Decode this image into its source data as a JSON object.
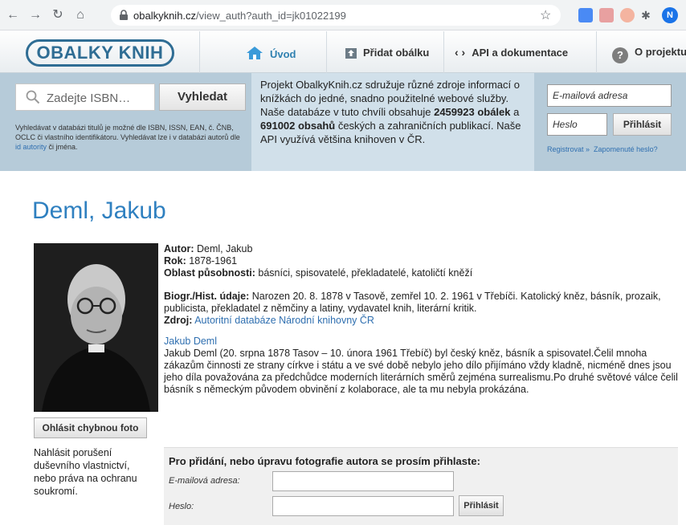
{
  "browser": {
    "url_domain": "obalkyknih.cz",
    "url_path": "/view_auth?auth_id=jk01022199",
    "avatar_letter": "N"
  },
  "header": {
    "logo": "OBALKY KNIH",
    "nav": [
      {
        "label": "Úvod",
        "icon": "home-icon"
      },
      {
        "label": "Přidat obálku",
        "icon": "upload-icon"
      },
      {
        "label": "API a dokumentace",
        "icon": "code-icon"
      },
      {
        "label": "O projektu",
        "icon": "help-icon"
      }
    ]
  },
  "search": {
    "placeholder": "Zadejte ISBN…",
    "button": "Vyhledat",
    "help_prefix": "Vyhledávat v databázi titulů je možné dle ISBN, ISSN, EAN, č. ČNB, OCLC či vlastního identifikátoru. Vyhledávat lze i v databázi autorů dle ",
    "help_link": "id autority",
    "help_suffix": " či jména."
  },
  "info": {
    "line1": "Projekt ObalkyKnih.cz sdružuje různé zdroje informací o knížkách do jedné, snadno použitelné webové služby. Naše databáze v tuto chvíli obsahuje ",
    "covers": "2459923 obálek",
    "mid": " a ",
    "contents": "691002 obsahů",
    "line2": " českých a zahraničních publikací. Naše API využívá většina knihoven v ČR."
  },
  "login": {
    "email_placeholder": "E-mailová adresa",
    "password_placeholder": "Heslo",
    "button": "Přihlásit",
    "register": "Registrovat »",
    "forgot": "Zapomenuté heslo?"
  },
  "author": {
    "name": "Deml, Jakub",
    "report_button": "Ohlásit chybnou foto",
    "rights_note": "Nahlásit porušení duševního vlastnictví, nebo práva na ochranu soukromí.",
    "fields": {
      "author_label": "Autor:",
      "author_value": " Deml, Jakub",
      "year_label": "Rok:",
      "year_value": " 1878-1961",
      "area_label": "Oblast působnosti:",
      "area_value": " básníci, spisovatelé, překladatelé, katoličtí kněží",
      "bio_label": "Biogr./Hist. údaje:",
      "bio_value": " Narozen 20. 8. 1878 v Tasově, zemřel 10. 2. 1961 v Třebíči. Katolický kněz, básník, prozaik, publicista, překladatel z němčiny a latiny, vydavatel knih, literární kritik.",
      "source_label": "Zdroj:",
      "source_value": "Autoritní databáze Národní knihovny ČR"
    },
    "wiki_title": "Jakub Deml",
    "wiki_text": "Jakub Deml (20. srpna 1878 Tasov – 10. února 1961 Třebíč) byl český kněz, básník a spisovatel.Čelil mnoha zákazům činnosti ze strany církve i státu a ve své době nebylo jeho dílo přijímáno vždy kladně, nicméně dnes jsou jeho díla považována za předchůdce moderních literárních směrů zejména surrealismu.Po druhé světové válce čelil básník s německým původem obvinění z kolaborace, ale ta mu nebyla prokázána."
  },
  "auth_panel": {
    "title": "Pro přidání, nebo úpravu fotografie autora se prosím přihlaste:",
    "email_label": "E-mailová adresa:",
    "password_label": "Heslo:",
    "button": "Přihlásit"
  }
}
